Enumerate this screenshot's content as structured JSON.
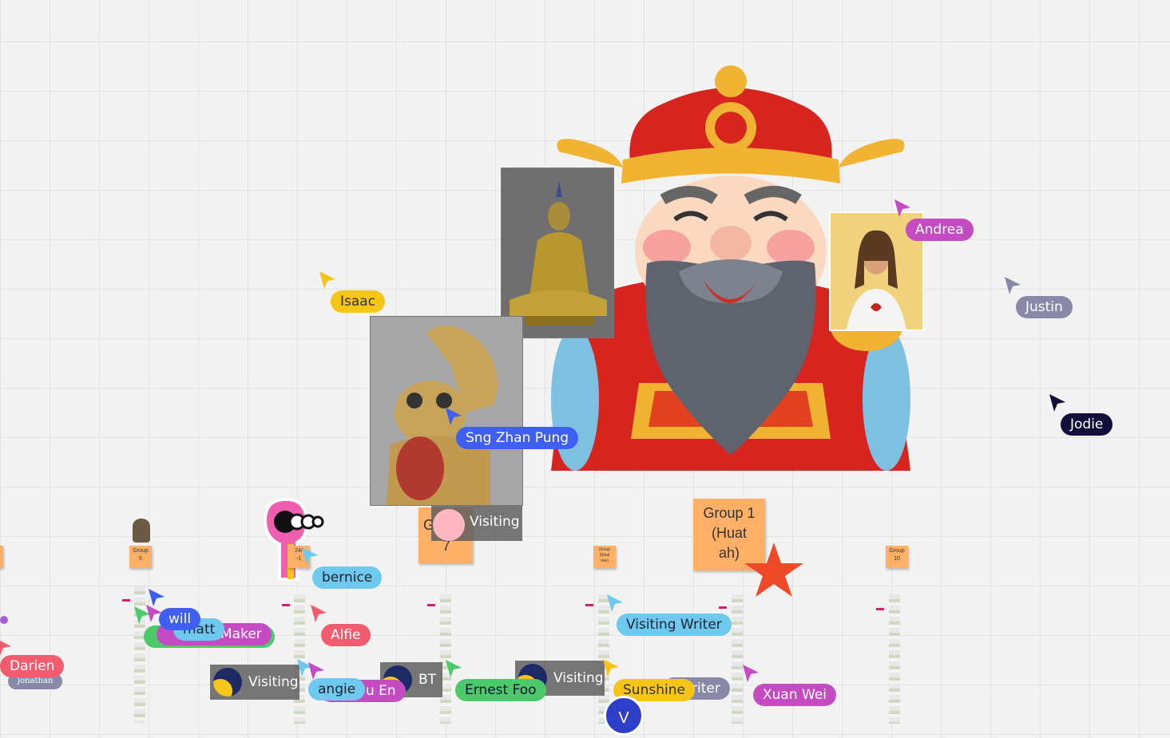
{
  "board": {
    "sticky_group1": [
      "Group 1",
      "(Huat",
      "ah)"
    ],
    "sticky_group7": [
      "G",
      "7"
    ],
    "small_stickies": [
      {
        "lines": [
          "Group",
          "5"
        ]
      },
      {
        "lines": [
          "24/",
          "-1"
        ]
      },
      {
        "lines": [
          "Group",
          "6(trial",
          "one)"
        ]
      },
      {
        "lines": [
          "Group",
          "10"
        ]
      }
    ],
    "visiting_boxes": [
      "Visiting",
      "Visiting",
      "Visiting",
      "BT"
    ]
  },
  "cursors": [
    {
      "name": "Isaac",
      "color": "#f5c518",
      "text_color": "#333"
    },
    {
      "name": "Andrea",
      "color": "#c44bc2"
    },
    {
      "name": "Justin",
      "color": "#8a88a8"
    },
    {
      "name": "Jodie",
      "color": "#10103a"
    },
    {
      "name": "Sng Zhan Pung",
      "color": "#3f5ef2"
    },
    {
      "name": "bernice",
      "color": "#6ec9ee",
      "text_color": "#223"
    },
    {
      "name": "will",
      "color": "#3f5ef2"
    },
    {
      "name": "matt",
      "color": "#6ec9ee"
    },
    {
      "name": "Maker",
      "color": "#c44bc2"
    },
    {
      "name": "Alfie",
      "color": "#f25c6e"
    },
    {
      "name": "Visiting Writer",
      "color": "#6ec9ee",
      "text_color": "#223"
    },
    {
      "name": "Darien",
      "color": "#f25c6e"
    },
    {
      "name": "jonathan",
      "color": "#8a88a8"
    },
    {
      "name": "angie",
      "color": "#6ec9ee",
      "text_color": "#223"
    },
    {
      "name": "u En",
      "color": "#c44bc2"
    },
    {
      "name": "Ernest Foo",
      "color": "#4cc96a",
      "text_color": "#113"
    },
    {
      "name": "Sunshine",
      "color": "#f5c518",
      "text_color": "#333"
    },
    {
      "name": "riter",
      "color": "#8a88a8"
    },
    {
      "name": "Xuan Wei",
      "color": "#c44bc2"
    },
    {
      "name": "V",
      "color": "#2d3ec8"
    }
  ],
  "colors": {
    "sticky": "#ffb066",
    "star": "#ee4a28",
    "grid": "#e3e3e3",
    "canvas": "#f2f2f2"
  },
  "icons": [
    "god-of-wealth-sticker",
    "buddha-statue-photo",
    "lucky-cat-sticker",
    "jesus-portrait-photo",
    "star-shape",
    "skull-sticker"
  ]
}
